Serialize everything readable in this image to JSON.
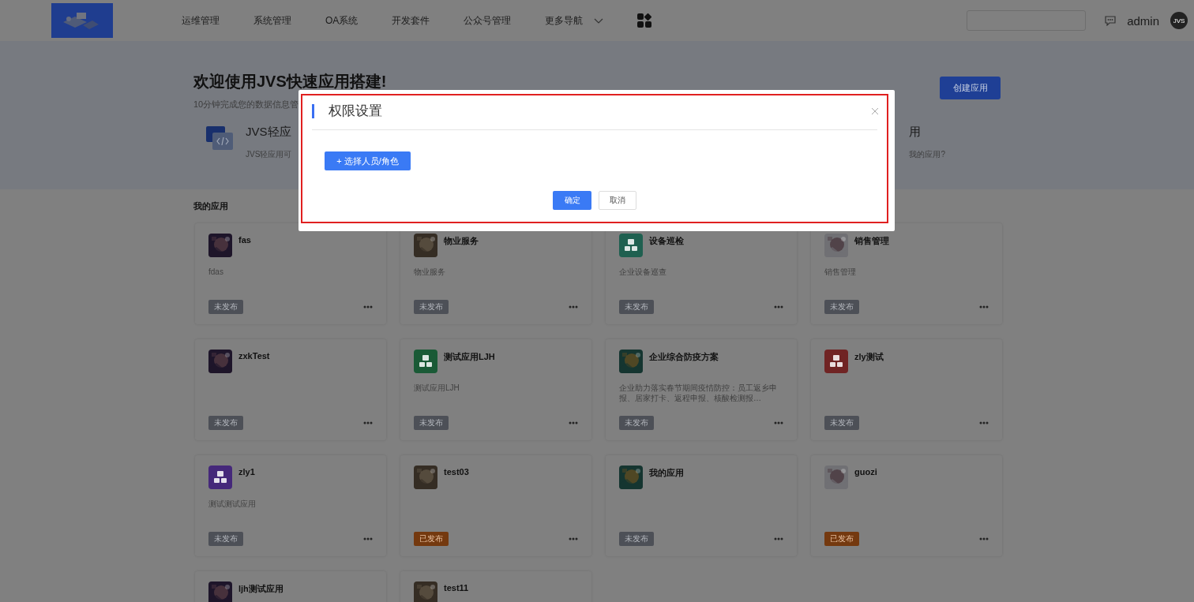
{
  "nav": {
    "items": [
      {
        "label": "运维管理"
      },
      {
        "label": "系统管理"
      },
      {
        "label": "OA系统"
      },
      {
        "label": "开发套件"
      },
      {
        "label": "公众号管理"
      },
      {
        "label": "更多导航",
        "dropdown": true
      }
    ],
    "user": "admin",
    "avatar_text": "JVS"
  },
  "hero": {
    "title": "欢迎使用JVS快速应用搭建!",
    "subtitle": "10分钟完成您的数据信息管",
    "create_button": "创建应用",
    "features": [
      {
        "title": "JVS轻应",
        "desc": "JVS轻应用可"
      },
      {
        "title": "用",
        "desc": "我的应用?"
      }
    ]
  },
  "section_title": "我的应用",
  "apps": [
    {
      "name": "fas",
      "desc": "fdas",
      "status": "未发布",
      "published": false,
      "kind": "picture"
    },
    {
      "name": "物业服务",
      "desc": "物业服务",
      "status": "未发布",
      "published": false,
      "kind": "picture"
    },
    {
      "name": "设备巡检",
      "desc": "企业设备巡查",
      "status": "未发布",
      "published": false,
      "kind": "icon",
      "color": "#1f6050"
    },
    {
      "name": "销售管理",
      "desc": "销售管理",
      "status": "未发布",
      "published": false,
      "kind": "picture"
    },
    {
      "name": "zxkTest",
      "status": "未发布",
      "published": false,
      "kind": "picture"
    },
    {
      "name": "测试应用LJH",
      "desc": "测试应用LJH",
      "status": "未发布",
      "published": false,
      "kind": "icon",
      "color": "#1a5a36"
    },
    {
      "name": "企业综合防疫方案",
      "desc": "企业助力落实春节期间疫情防控：员工返乡申报、居家打卡、返程申报、核酸检测报…",
      "status": "未发布",
      "published": false,
      "kind": "picture"
    },
    {
      "name": "zly测试",
      "status": "未发布",
      "published": false,
      "kind": "icon",
      "color": "#702424"
    },
    {
      "name": "zly1",
      "desc": "测试测试应用",
      "status": "未发布",
      "published": false,
      "kind": "icon",
      "color": "#45287a"
    },
    {
      "name": "test03",
      "status": "已发布",
      "published": true,
      "kind": "picture"
    },
    {
      "name": "我的应用",
      "status": "未发布",
      "published": false,
      "kind": "picture"
    },
    {
      "name": "guozi",
      "status": "已发布",
      "published": true,
      "kind": "picture"
    },
    {
      "name": "ljh测试应用",
      "kind": "picture"
    },
    {
      "name": "test11",
      "kind": "picture"
    }
  ],
  "dialog": {
    "title": "权限设置",
    "add_button": "+ 选择人员/角色",
    "confirm": "确定",
    "cancel": "取消"
  }
}
